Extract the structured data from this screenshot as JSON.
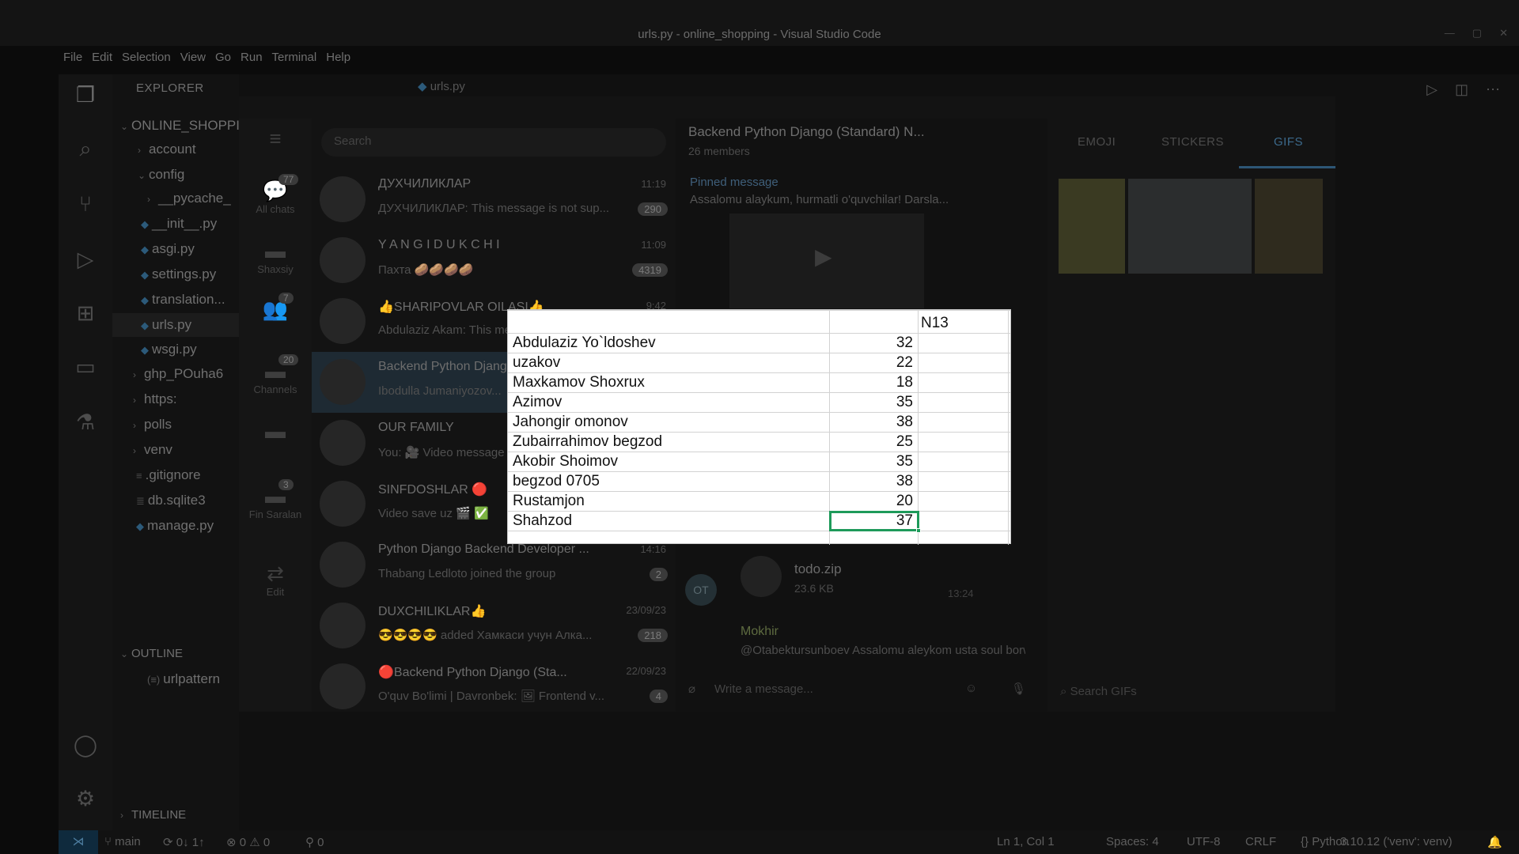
{
  "window": {
    "title": "urls.py - online_shopping - Visual Studio Code",
    "controls": [
      "—",
      "▢",
      "✕"
    ]
  },
  "menu": [
    "File",
    "Edit",
    "Selection",
    "View",
    "Go",
    "Run",
    "Terminal",
    "Help"
  ],
  "explorer": {
    "header": "EXPLORER",
    "project": "ONLINE_SHOPPI",
    "items": [
      {
        "label": "account"
      },
      {
        "label": "config"
      },
      {
        "label": "__pycache_"
      },
      {
        "label": "__init__.py"
      },
      {
        "label": "asgi.py"
      },
      {
        "label": "settings.py"
      },
      {
        "label": "translation..."
      },
      {
        "label": "urls.py"
      },
      {
        "label": "wsgi.py"
      },
      {
        "label": "ghp_POuha6"
      },
      {
        "label": "https:"
      },
      {
        "label": "polls"
      },
      {
        "label": "venv"
      },
      {
        "label": ".gitignore"
      },
      {
        "label": "db.sqlite3"
      },
      {
        "label": "manage.py"
      }
    ],
    "outline_header": "OUTLINE",
    "outline_item": "urlpattern",
    "timeline_header": "TIMELINE"
  },
  "editor": {
    "tab": "urls.py"
  },
  "statusbar": {
    "branch": "main",
    "sync": "0↓ 1↑",
    "problems": "⊗ 0 ⚠ 0",
    "ports": "⚲ 0",
    "position": "Ln 1, Col 1",
    "spaces": "Spaces: 4",
    "encoding": "UTF-8",
    "eol": "CRLF",
    "language": "Python",
    "interpreter": "3.10.12 ('venv': venv)"
  },
  "telegram": {
    "search_placeholder": "Search",
    "folders": [
      {
        "label": "All chats",
        "badge": "77"
      },
      {
        "label": "Shaxsiy",
        "badge": ""
      },
      {
        "label": "",
        "badge": "7"
      },
      {
        "label": "Channels",
        "badge": "20"
      },
      {
        "label": "",
        "badge": ""
      },
      {
        "label": "Fin Saralan",
        "badge": "3"
      },
      {
        "label": "Edit",
        "badge": ""
      }
    ],
    "chats": [
      {
        "name": "ДУХЧИЛИКЛАР",
        "time": "11:19",
        "preview": "ДУХЧИЛИКЛАР: This message is not sup...",
        "badge": "290"
      },
      {
        "name": "Y A N G I D U K C H I",
        "time": "11:09",
        "preview": "Пахта 🥔🥔🥔🥔",
        "badge": "4319"
      },
      {
        "name": "👍SHARIPOVLAR OILASI👍",
        "time": "9:42",
        "preview": "Abdulaziz Akam: This message is not...",
        "badge": ""
      },
      {
        "name": "Backend Python Django",
        "time": "",
        "preview": "Ibodulla Jumaniyozov...",
        "badge": ""
      },
      {
        "name": "OUR FAMILY",
        "time": "",
        "preview": "You: 🎥 Video message",
        "badge": ""
      },
      {
        "name": "SINFDOSHLAR 🔴",
        "time": "",
        "preview": "Video save uz 🎬 ✅",
        "badge": ""
      },
      {
        "name": "Python Django Backend Developer ...",
        "time": "14:16",
        "preview": "Thabang Ledloto joined the group",
        "badge": "2"
      },
      {
        "name": "DUXCHILIKLAR👍",
        "time": "23/09/23",
        "preview": "😎😎😎😎 added Хамкаси учун Алка...",
        "badge": "218"
      },
      {
        "name": "🔴Backend Python Django (Sta...",
        "time": "22/09/23",
        "preview": "O'quv Bo'limi | Davronbek: 🖼 Frontend v...",
        "badge": "4"
      }
    ],
    "conversation": {
      "title": "Backend Python Django (Standard) N...",
      "subtitle": "26 members",
      "pinned_label": "Pinned message",
      "pinned_text": "Assalomu alaykum, hurmatli o'quvchilar!  Darsla...",
      "file_name": "todo.zip",
      "file_size": "23.6 KB",
      "file_time": "13:24",
      "avatar_initials": "OT",
      "reply_name": "Mokhir",
      "reply_text": "@Otabektursunboev Assalomu aleykom usta soul borwdi ikkta App ga bitta modeltranslation",
      "compose_placeholder": "Write a message..."
    },
    "gif_tabs": [
      "EMOJI",
      "STICKERS",
      "GIFS"
    ],
    "gif_search": "Search GIFs"
  },
  "sheet": {
    "header_n": "N13",
    "rows": [
      {
        "name": "Abdulaziz Yo`ldoshev",
        "score": "32"
      },
      {
        "name": "uzakov",
        "score": "22"
      },
      {
        "name": "Maxkamov Shoxrux",
        "score": "18"
      },
      {
        "name": "Azimov",
        "score": "35"
      },
      {
        "name": "Jahongir omonov",
        "score": "38"
      },
      {
        "name": "Zubairrahimov begzod",
        "score": "25"
      },
      {
        "name": "Akobir Shoimov",
        "score": "35"
      },
      {
        "name": "begzod 0705",
        "score": "38"
      },
      {
        "name": "Rustamjon",
        "score": "20"
      },
      {
        "name": "Shahzod",
        "score": "37"
      }
    ]
  }
}
